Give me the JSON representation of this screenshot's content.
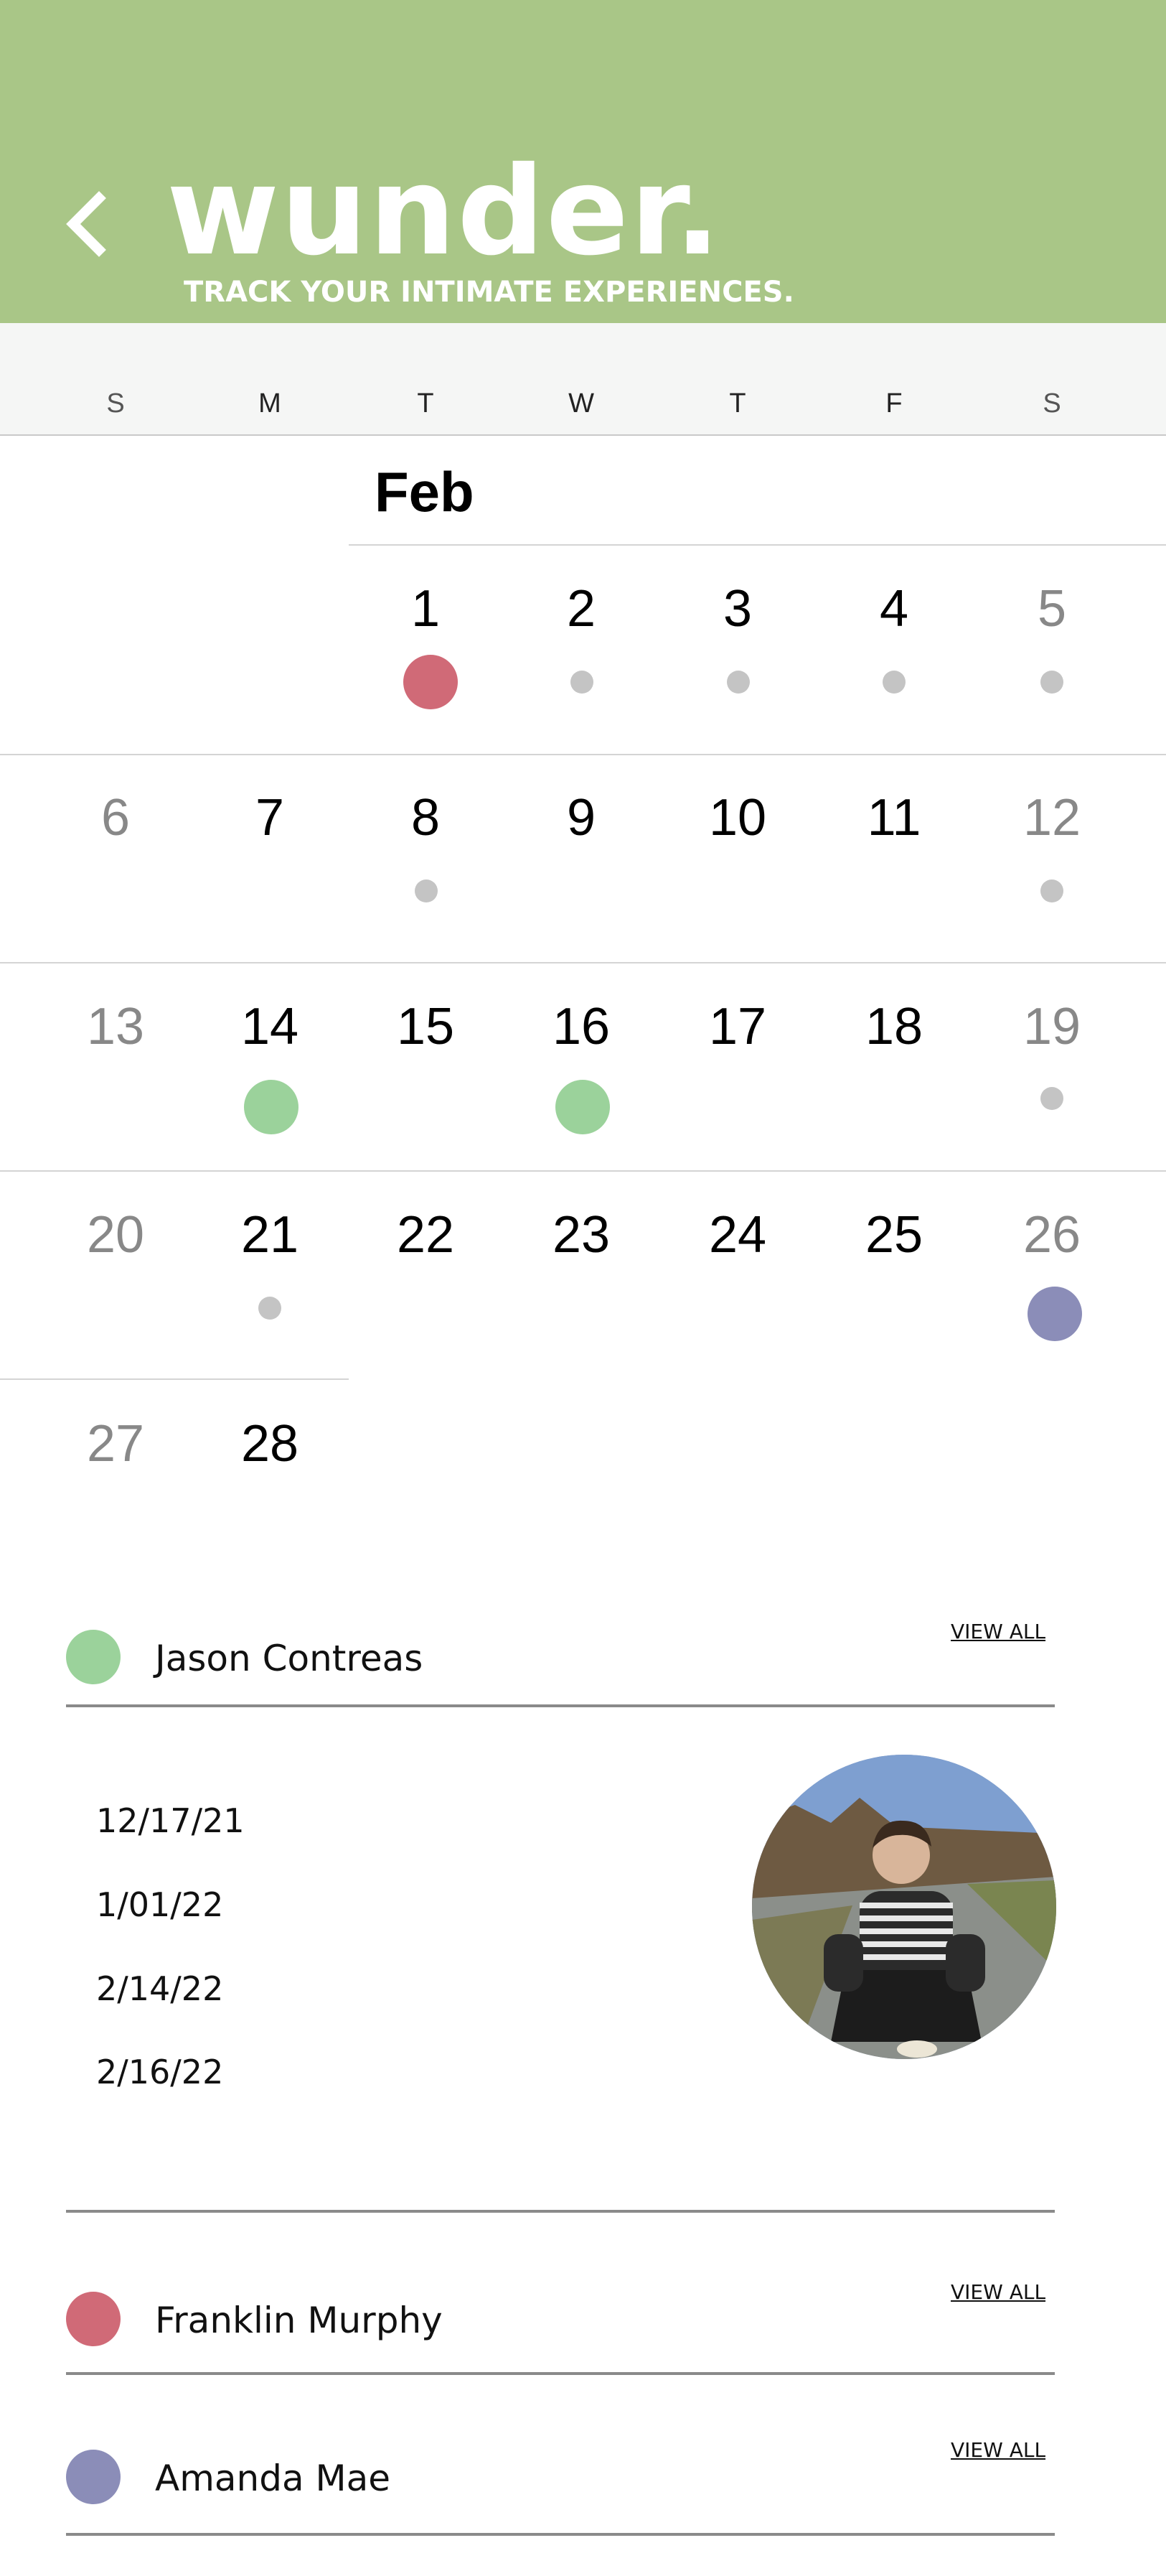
{
  "header": {
    "brand": "wunder.",
    "tagline": "TRACK YOUR INTIMATE EXPERIENCES.",
    "back_icon": "chevron-left-icon",
    "background": "#a9c687"
  },
  "weekdays": [
    "S",
    "M",
    "T",
    "W",
    "T",
    "F",
    "S"
  ],
  "calendar": {
    "month": "Feb",
    "days": [
      "1",
      "2",
      "3",
      "4",
      "5",
      "6",
      "7",
      "8",
      "9",
      "10",
      "11",
      "12",
      "13",
      "14",
      "15",
      "16",
      "17",
      "18",
      "19",
      "20",
      "21",
      "22",
      "23",
      "24",
      "25",
      "26",
      "27",
      "28"
    ],
    "marked_days": {
      "1": "Franklin Murphy",
      "14": "Jason Contreas",
      "16": "Jason Contreas",
      "26": "Amanda Mae"
    },
    "dotted_days": [
      "2",
      "3",
      "4",
      "5",
      "8",
      "12",
      "19",
      "21"
    ]
  },
  "colors": {
    "jason": "#9bd29b",
    "franklin": "#d06a77",
    "amanda": "#8b8db8",
    "small_dot": "#c4c4c4"
  },
  "partners": [
    {
      "name": "Jason Contreas",
      "view_all": "VIEW ALL",
      "dates": [
        "12/17/21",
        "1/01/22",
        "2/14/22",
        "2/16/22"
      ]
    },
    {
      "name": "Franklin Murphy",
      "view_all": "VIEW ALL"
    },
    {
      "name": "Amanda Mae",
      "view_all": "VIEW ALL"
    }
  ]
}
